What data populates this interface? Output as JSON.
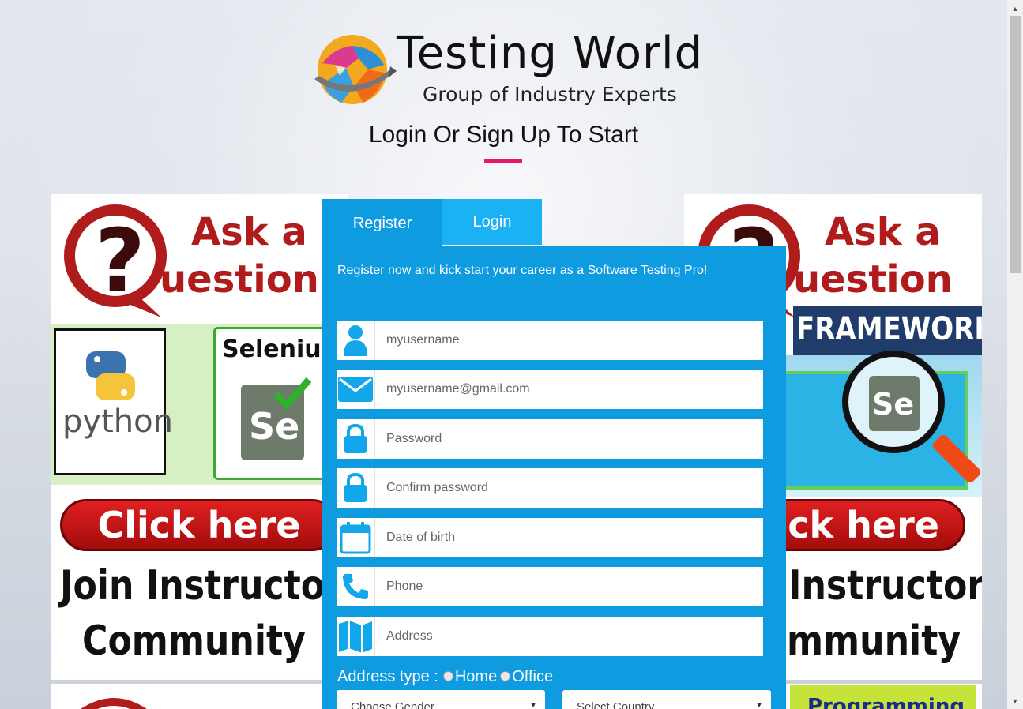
{
  "header": {
    "logo_title": "Testing World",
    "logo_subtitle": "Group of Industry Experts",
    "page_title": "Login Or Sign Up To Start",
    "accent_color": "#e8196b"
  },
  "ads": {
    "left": {
      "question_top": "Ask a",
      "question_bottom": "uestion",
      "python_label": "python",
      "selenium_label": "Selenium",
      "se_label": "Se",
      "click_label": "Click here",
      "join_line1": "Join Instructor",
      "join_line2": "Community"
    },
    "right": {
      "question_top": "Ask a",
      "question_bottom": "uestion",
      "framework_label": "FRAMEWORK",
      "se_label": "Se",
      "click_label": "ck here",
      "join_line1": "Instructor",
      "join_line2": "mmunity",
      "bottom_label": "Programming"
    }
  },
  "tabs": {
    "register": "Register",
    "login": "Login"
  },
  "form": {
    "intro": "Register now and kick start your career as a Software Testing Pro!",
    "fields": [
      {
        "placeholder": "myusername",
        "icon": "user-icon"
      },
      {
        "placeholder": "myusername@gmail.com",
        "icon": "envelope-icon"
      },
      {
        "placeholder": "Password",
        "icon": "lock-icon"
      },
      {
        "placeholder": "Confirm password",
        "icon": "lock-icon"
      },
      {
        "placeholder": "Date of birth",
        "icon": "calendar-icon"
      },
      {
        "placeholder": "Phone",
        "icon": "phone-icon"
      },
      {
        "placeholder": "Address",
        "icon": "map-icon"
      }
    ],
    "address_type_label": "Address type :",
    "address_options": [
      "Home",
      "Office"
    ],
    "gender_select": "Choose Gender",
    "country_select": "Select Country"
  },
  "colors": {
    "panel": "#0f9be0",
    "login_tab": "#1ab2f3",
    "icon": "#12a6ea"
  }
}
